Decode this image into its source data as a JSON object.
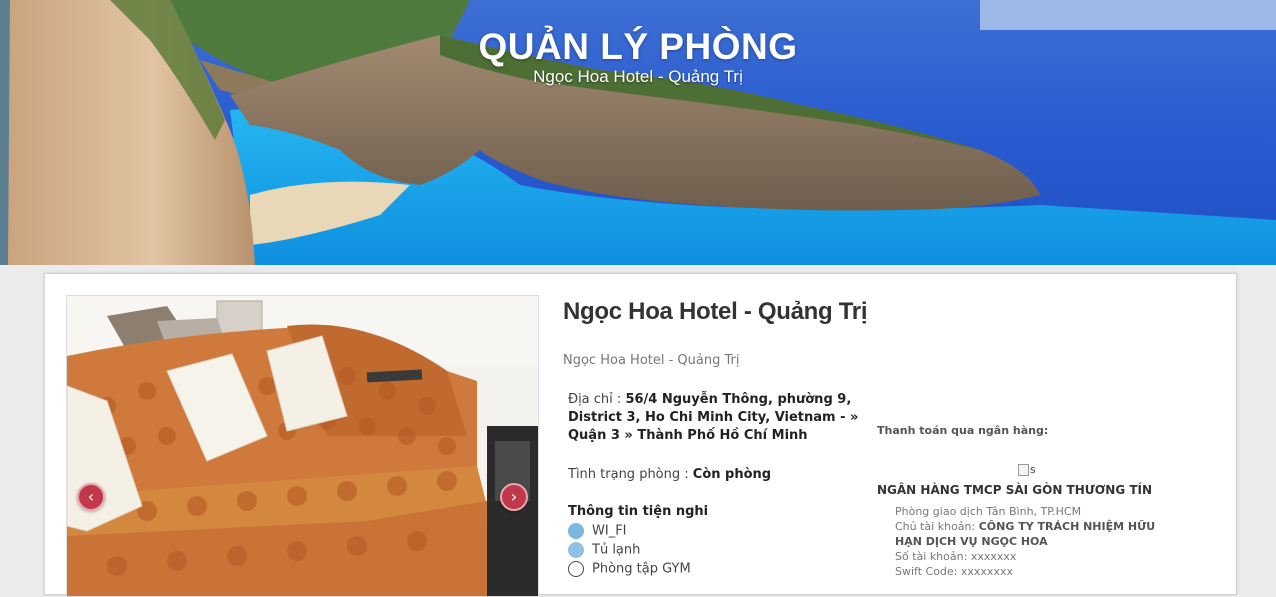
{
  "header": {
    "title": "QUẢN LÝ PHÒNG",
    "subtitle": "Ngọc Hoa Hotel - Quảng Trị"
  },
  "hotel": {
    "name": "Ngọc Hoa Hotel - Quảng Trị",
    "sub_name": "Ngọc Hoa Hotel - Quảng Trị",
    "address_label": "Địa chỉ : ",
    "address_value": "56/4 Nguyễn Thông, phường 9, District 3, Ho Chi Minh City, Vietnam - » Quận 3 » Thành Phố Hồ Chí Minh",
    "status_label": "Tình trạng phòng : ",
    "status_value": "Còn phòng"
  },
  "gallery": {
    "prev_icon": "chevron-left-icon",
    "next_icon": "chevron-right-icon",
    "prev_glyph": "‹",
    "next_glyph": "›"
  },
  "amenities": {
    "title": "Thông tin tiện nghi",
    "items": [
      {
        "icon": "wifi-icon",
        "label": "WI_FI"
      },
      {
        "icon": "fridge-icon",
        "label": "Tủ lạnh"
      },
      {
        "icon": "gym-icon",
        "label": "Phòng tập GYM"
      }
    ]
  },
  "payment": {
    "label": "Thanh toán qua ngân hàng:",
    "image_alt": "s",
    "bank_name": "NGÂN HÀNG TMCP SÀI GÒN THƯƠNG TÍN",
    "branch": "Phòng giao dịch Tân Bình, TP.HCM",
    "holder_label": "Chủ tài khoản: ",
    "holder_value": "CÔNG TY TRÁCH NHIỆM HỮU HẠN DỊCH VỤ NGỌC HOA",
    "account_label": "Số tài khoản: ",
    "account_value": "xxxxxxx",
    "swift_label": "Swift Code: ",
    "swift_value": "xxxxxxxx"
  }
}
